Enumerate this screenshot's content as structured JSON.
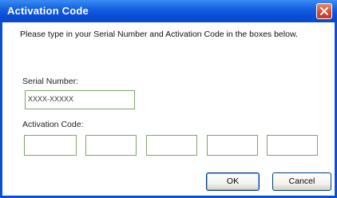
{
  "window": {
    "title": "Activation Code"
  },
  "instruction": "Please type in your Serial Number and Activation Code in the boxes below.",
  "serial": {
    "label": "Serial Number:",
    "value": "XXXX-XXXXX"
  },
  "activation": {
    "label": "Activation Code:",
    "boxes": [
      "",
      "",
      "",
      "",
      ""
    ]
  },
  "buttons": {
    "ok": "OK",
    "cancel": "Cancel"
  },
  "colors": {
    "titlebar": "#0a4fd8",
    "field_border": "#7fa36a",
    "close": "#d4472a"
  },
  "icons": {
    "close": "close-icon"
  }
}
